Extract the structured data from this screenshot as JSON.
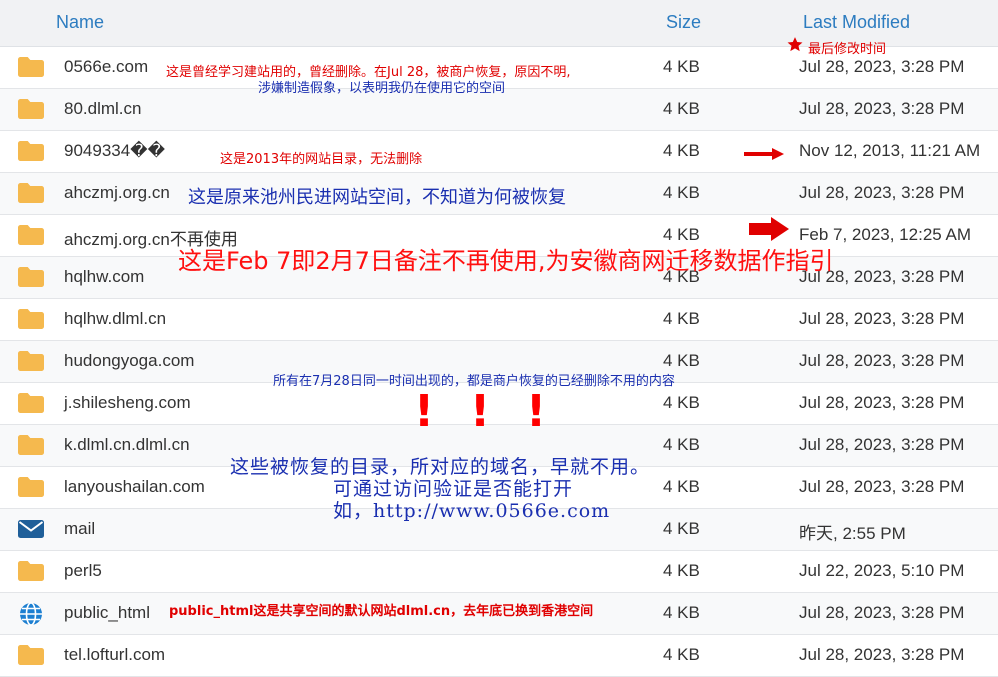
{
  "columns": {
    "name": "Name",
    "size": "Size",
    "modified": "Last Modified"
  },
  "rows": [
    {
      "icon": "folder-icon",
      "name": "0566e.com",
      "size": "4 KB",
      "modified": "Jul 28, 2023, 3:28 PM"
    },
    {
      "icon": "folder-icon",
      "name": "80.dlml.cn",
      "size": "4 KB",
      "modified": "Jul 28, 2023, 3:28 PM"
    },
    {
      "icon": "folder-icon",
      "name": "9049334��",
      "size": "4 KB",
      "modified": "Nov 12, 2013, 11:21 AM"
    },
    {
      "icon": "folder-icon",
      "name": "ahczmj.org.cn",
      "size": "4 KB",
      "modified": "Jul 28, 2023, 3:28 PM"
    },
    {
      "icon": "folder-icon",
      "name": "ahczmj.org.cn不再使用",
      "size": "4 KB",
      "modified": "Feb 7, 2023, 12:25 AM"
    },
    {
      "icon": "folder-icon",
      "name": "hqlhw.com",
      "size": "4 KB",
      "modified": "Jul 28, 2023, 3:28 PM"
    },
    {
      "icon": "folder-icon",
      "name": "hqlhw.dlml.cn",
      "size": "4 KB",
      "modified": "Jul 28, 2023, 3:28 PM"
    },
    {
      "icon": "folder-icon",
      "name": "hudongyoga.com",
      "size": "4 KB",
      "modified": "Jul 28, 2023, 3:28 PM"
    },
    {
      "icon": "folder-icon",
      "name": "j.shilesheng.com",
      "size": "4 KB",
      "modified": "Jul 28, 2023, 3:28 PM"
    },
    {
      "icon": "folder-icon",
      "name": "k.dlml.cn.dlml.cn",
      "size": "4 KB",
      "modified": "Jul 28, 2023, 3:28 PM"
    },
    {
      "icon": "folder-icon",
      "name": "lanyoushailan.com",
      "size": "4 KB",
      "modified": "Jul 28, 2023, 3:28 PM"
    },
    {
      "icon": "mail-icon",
      "name": "mail",
      "size": "4 KB",
      "modified": "昨天, 2:55 PM"
    },
    {
      "icon": "folder-icon",
      "name": "perl5",
      "size": "4 KB",
      "modified": "Jul 22, 2023, 5:10 PM"
    },
    {
      "icon": "globe-icon",
      "name": "public_html",
      "size": "4 KB",
      "modified": "Jul 28, 2023, 3:28 PM"
    },
    {
      "icon": "folder-icon",
      "name": "tel.lofturl.com",
      "size": "4 KB",
      "modified": "Jul 28, 2023, 3:28 PM"
    }
  ],
  "annotations": {
    "last_modified_note": "最后修改时间",
    "row0_line1": "这是曾经学习建站用的，曾经删除。在Jul 28，被商户恢复，原因不明,",
    "row0_line2": "涉嫌制造假象，以表明我仍在使用它的空间",
    "row2_note": "这是2013年的网站目录，无法删除",
    "row3_note": "这是原来池州民进网站空间，不知道为何被恢复",
    "feb7_note": "这是Feb 7即2月7日备注不再使用,为安徽商网迁移数据作指引",
    "same_time_note": "所有在7月28日同一时间出现的，都是商户恢复的已经删除不用的内容",
    "bangs": "！！！",
    "restored_line1": "这些被恢复的目录，所对应的域名，早就不用。",
    "restored_line2": "可通过访问验证是否能打开",
    "restored_line3": "如，http://www.0566e.com",
    "public_html_note": "public_html这是共享空间的默认网站dlml.cn，去年底已换到香港空间"
  },
  "colors": {
    "header_bg": "#f1f2f4",
    "header_text": "#2c7cc0",
    "folder": "#f5b94e",
    "mail": "#1f5f99",
    "globe": "#1c7fd1",
    "annotation_red": "#e00000",
    "annotation_blue": "#1a2fb0"
  }
}
